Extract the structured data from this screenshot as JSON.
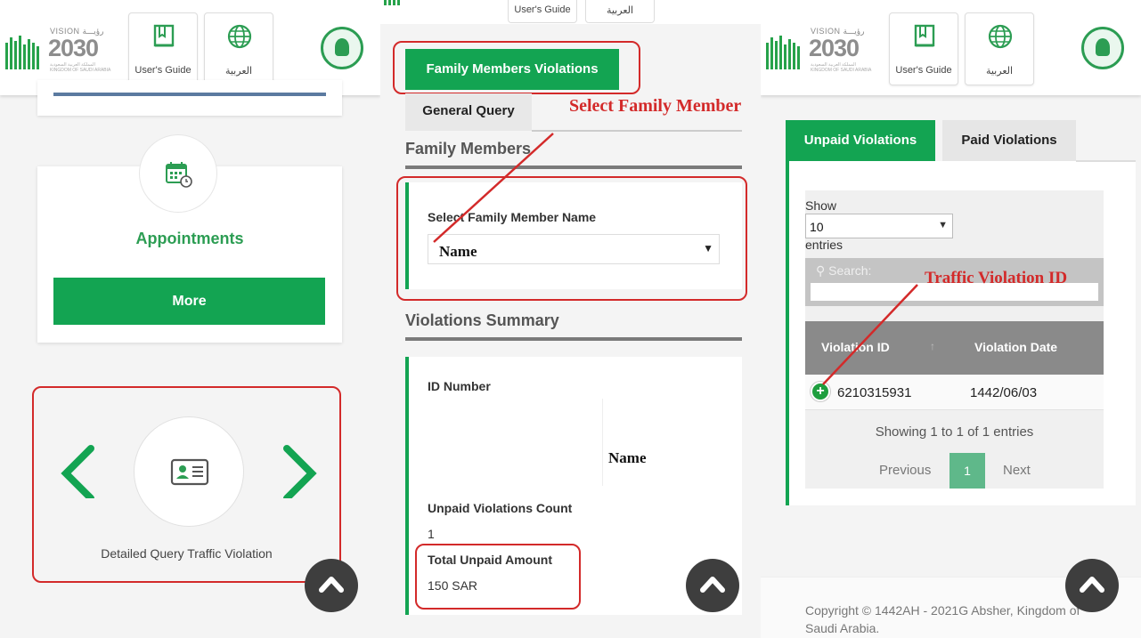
{
  "header": {
    "vision_small": "VISION رؤيـــة",
    "vision_year": "2030",
    "vision_sub": "المملكة العربية السعودية KINGDOM OF SAUDI ARABIA",
    "users_guide_label": "User's Guide",
    "arabic_label": "العربية"
  },
  "panel1": {
    "appointments_title": "Appointments",
    "more_label": "More",
    "detailed_query_label": "Detailed Query Traffic Violation"
  },
  "panel2": {
    "family_members_violations_tab": "Family Members Violations",
    "general_query_tab": "General Query",
    "annotation_select_member": "Select Family Member",
    "family_members_title": "Family Members",
    "select_member_label": "Select Family Member Name",
    "select_member_value": "Name",
    "violations_summary_title": "Violations Summary",
    "id_number_label": "ID Number",
    "name_overlay": "Name",
    "unpaid_count_label": "Unpaid Violations Count",
    "unpaid_count_value": "1",
    "total_unpaid_label": "Total Unpaid Amount",
    "total_unpaid_value": "150 SAR"
  },
  "panel3": {
    "unpaid_tab": "Unpaid Violations",
    "paid_tab": "Paid Violations",
    "show_label": "Show",
    "entries_value": "10",
    "entries_label": "entries",
    "search_label": "Search:",
    "annotation_violation_id": "Traffic Violation ID",
    "columns": [
      "Violation ID",
      "Violation Date"
    ],
    "rows": [
      {
        "violation_id": "6210315931",
        "violation_date": "1442/06/03"
      }
    ],
    "info_text": "Showing 1 to 1 of 1 entries",
    "previous_label": "Previous",
    "current_page": "1",
    "next_label": "Next",
    "footer_text": "Copyright © 1442AH - 2021G Absher, Kingdom of Saudi Arabia."
  },
  "colors": {
    "primary_green": "#13a452",
    "annotation_red": "#d32a2a",
    "table_header_gray": "#8a8a8a",
    "scroll_button": "#3e3e3e"
  }
}
